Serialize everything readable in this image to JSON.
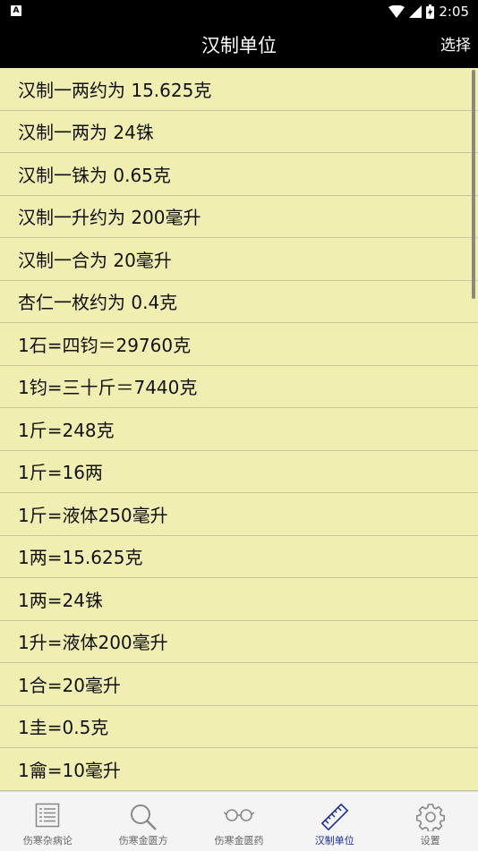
{
  "status_bar": {
    "time": "2:05",
    "icons": [
      "app-notification-icon",
      "wifi-icon",
      "cell-signal-icon",
      "battery-icon"
    ]
  },
  "header": {
    "title": "汉制单位",
    "select_label": "选择"
  },
  "list": {
    "items": [
      "汉制一两约为 15.625克",
      "汉制一两为 24铢",
      "汉制一铢为 0.65克",
      "汉制一升约为 200毫升",
      "汉制一合为 20毫升",
      "杏仁一枚约为 0.4克",
      "1石=四钧＝29760克",
      "1钧=三十斤＝7440克",
      "1斤=248克",
      "1斤=16两",
      "1斤=液体250毫升",
      "1两=15.625克",
      "1两=24铢",
      "1升=液体200毫升",
      "1合=20毫升",
      "1圭=0.5克",
      "1龠=10毫升"
    ]
  },
  "tabs": [
    {
      "label": "伤寒杂病论",
      "icon": "list-icon",
      "active": false
    },
    {
      "label": "伤寒金匮方",
      "icon": "search-icon",
      "active": false
    },
    {
      "label": "伤寒金匮药",
      "icon": "glasses-icon",
      "active": false
    },
    {
      "label": "汉制单位",
      "icon": "ruler-icon",
      "active": true
    },
    {
      "label": "设置",
      "icon": "gear-icon",
      "active": false
    }
  ],
  "colors": {
    "list_background": "#f0eeb0",
    "header_background": "#000000",
    "active_tab": "#1a2b9c",
    "inactive_tab": "#666666"
  }
}
